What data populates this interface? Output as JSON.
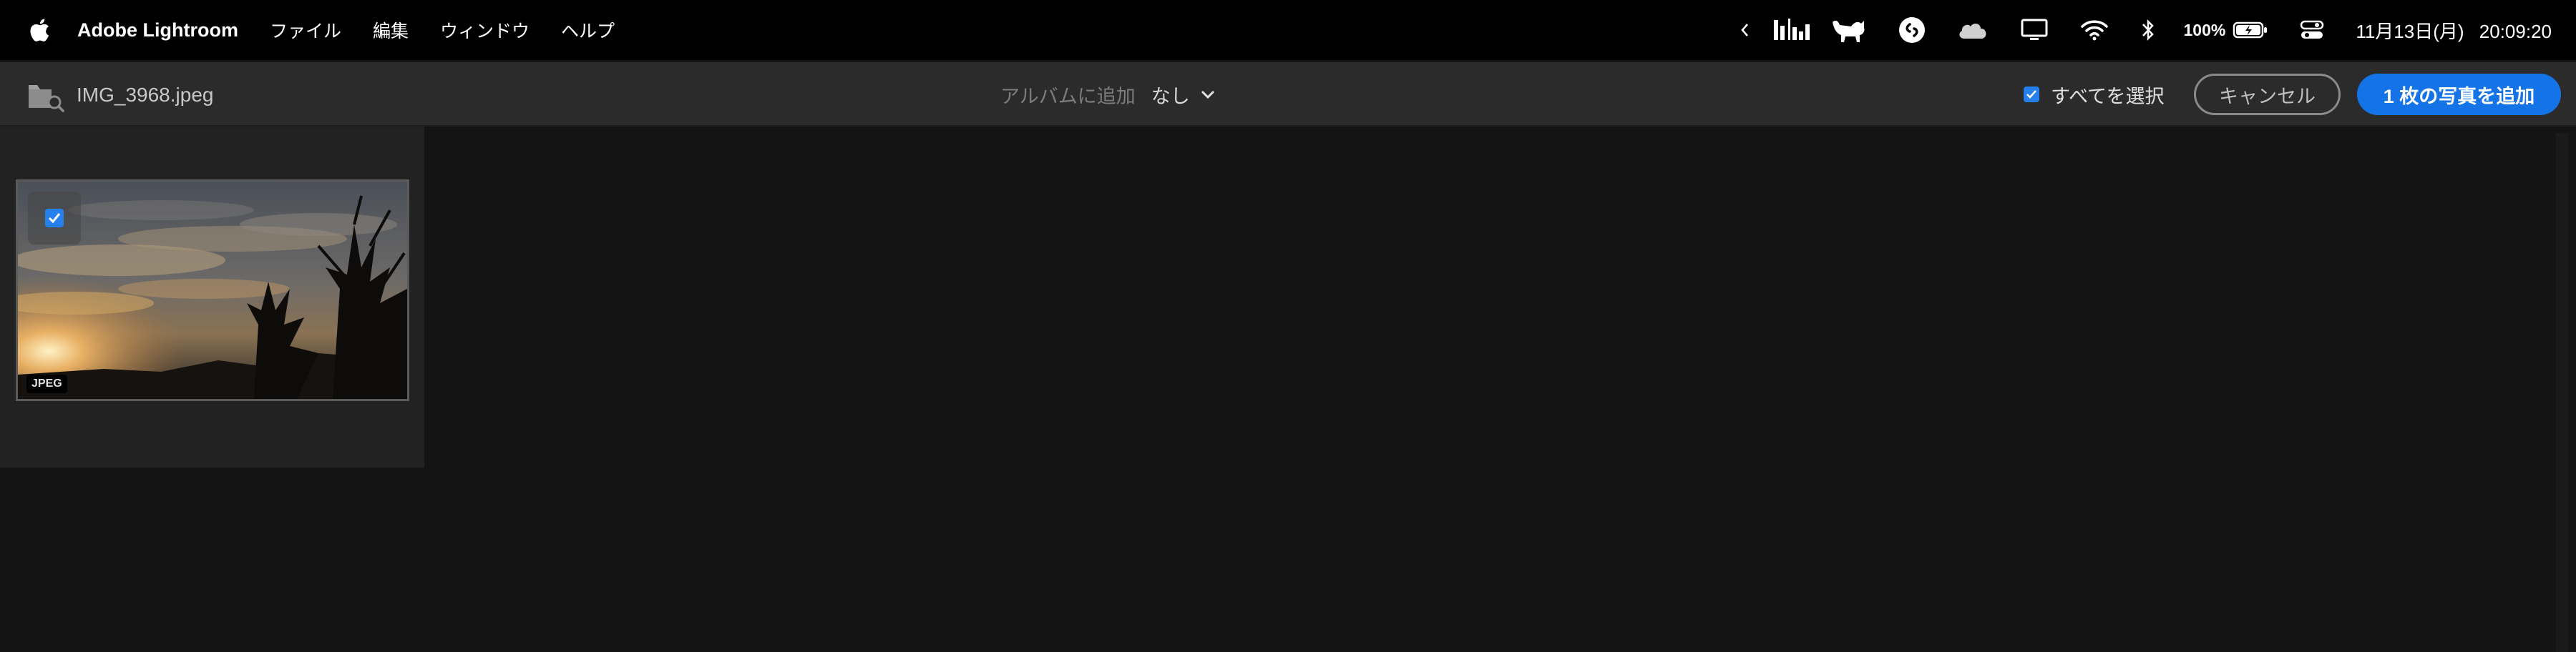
{
  "menubar": {
    "app_name": "Adobe Lightroom",
    "menus": [
      "ファイル",
      "編集",
      "ウィンドウ",
      "ヘルプ"
    ],
    "battery_text": "100%",
    "clock_date": "11月13日(月)",
    "clock_time": "20:09:20",
    "tray_icons": [
      "chevron-left-icon",
      "stats-bars-icon",
      "cat-icon",
      "shazam-icon",
      "cloud-icon",
      "display-icon",
      "wifi-icon",
      "bluetooth-icon",
      "battery-icon",
      "control-center-icon"
    ]
  },
  "toolbar": {
    "filename": "IMG_3968.jpeg",
    "album_label": "アルバムに追加",
    "album_value": "なし",
    "select_all_label": "すべてを選択",
    "select_all_checked": true,
    "cancel_label": "キャンセル",
    "add_label": "1 枚の写真を追加"
  },
  "grid": {
    "photos": [
      {
        "badge": "JPEG",
        "selected": true
      }
    ]
  },
  "colors": {
    "accent": "#1473e6",
    "checkbox": "#2680eb",
    "toolbar_bg": "#2b2b2b",
    "content_bg": "#141414"
  }
}
